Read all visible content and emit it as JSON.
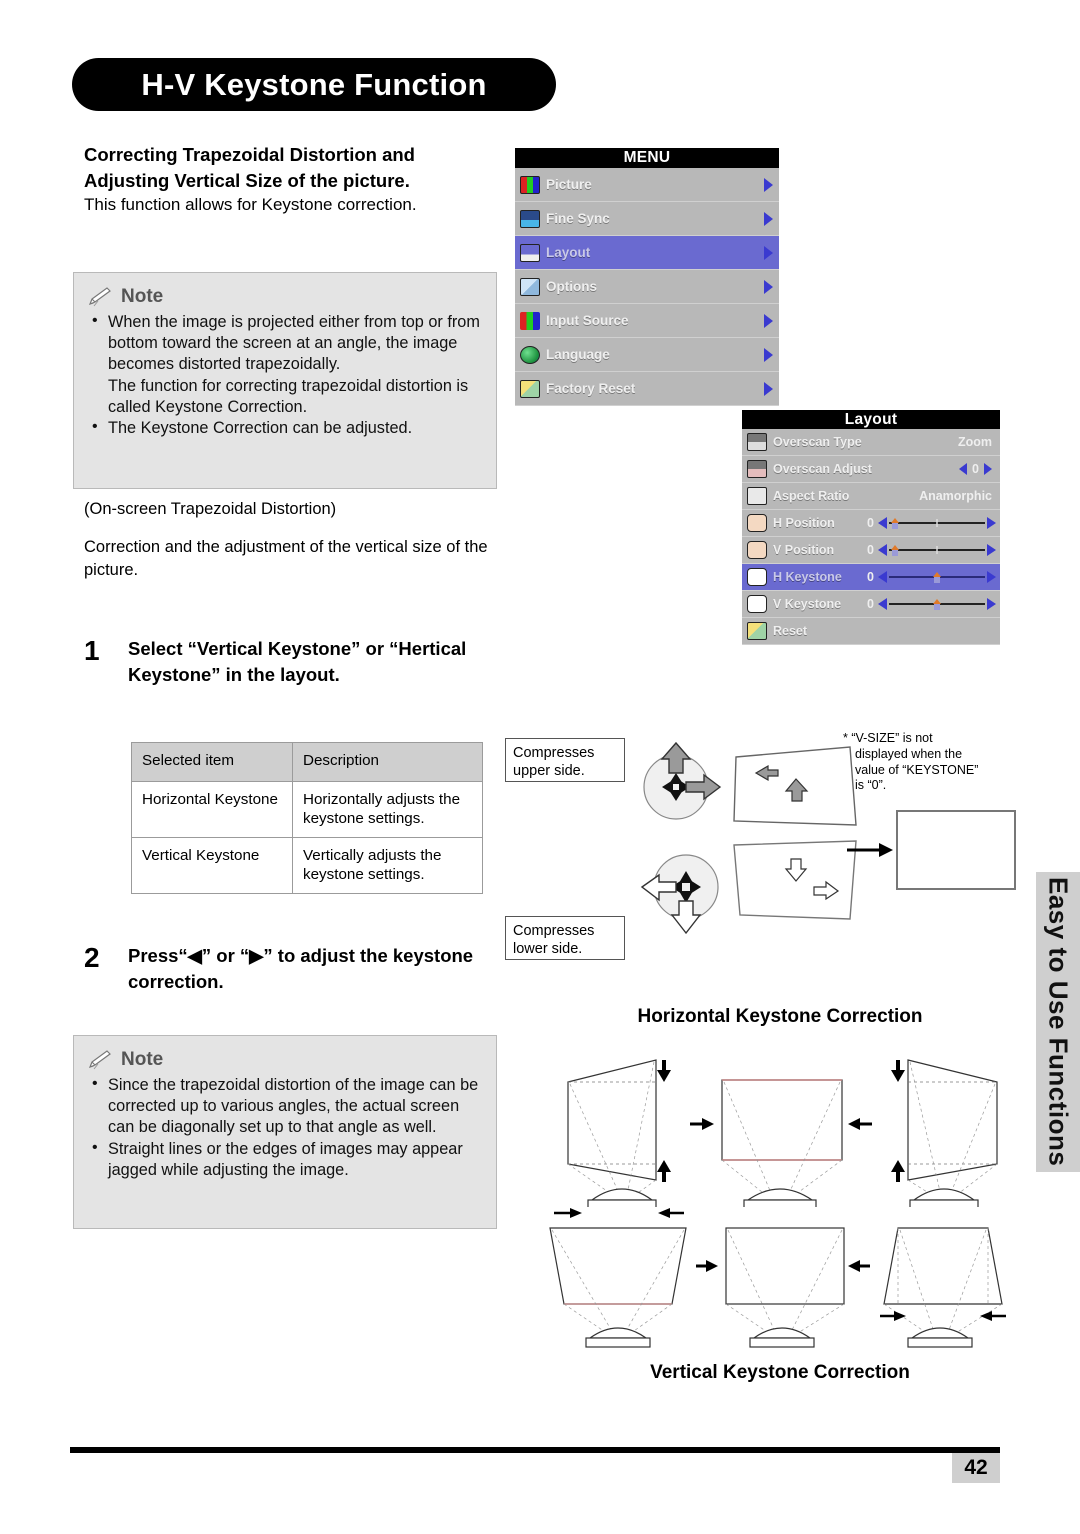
{
  "header": {
    "title": "H-V Keystone Function"
  },
  "intro": {
    "heading": "Correcting Trapezoidal Distortion and Adjusting Vertical Size of the picture.",
    "subtext": "This function allows for Keystone correction."
  },
  "note1": {
    "label": "Note",
    "items": [
      "When the image is projected either from top or from bottom toward the screen at an angle, the image becomes distorted trapezoidally.",
      "The function for correcting trapezoidal distortion is called Keystone Correction.",
      "The Keystone Correction can be adjusted."
    ]
  },
  "body": {
    "line1": "(On-screen Trapezoidal Distortion)",
    "line2": "Correction and the adjustment of the vertical size of the picture."
  },
  "steps": [
    {
      "number": "1",
      "text": "Select “Vertical Keystone” or “Hertical Keystone” in the layout."
    },
    {
      "number": "2",
      "text": "Press“◀” or “▶” to adjust the keystone correction."
    }
  ],
  "table": {
    "headers": [
      "Selected item",
      "Description"
    ],
    "rows": [
      {
        "item": "Horizontal Keystone",
        "description": "Horizontally adjusts the keystone settings."
      },
      {
        "item": "Vertical Keystone",
        "description": "Vertically adjusts the keystone settings."
      }
    ]
  },
  "note2": {
    "label": "Note",
    "items": [
      "Since the trapezoidal distortion of the image can be corrected up to various angles, the actual screen can be diagonally set up to that angle as well.",
      "Straight lines or the edges of images may appear jagged while adjusting the image."
    ]
  },
  "osd_main": {
    "title": "MENU",
    "items": [
      {
        "label": "Picture",
        "icon": "picture-icon",
        "selected": false
      },
      {
        "label": "Fine Sync",
        "icon": "fine-sync-icon",
        "selected": false
      },
      {
        "label": "Layout",
        "icon": "layout-icon",
        "selected": true
      },
      {
        "label": "Options",
        "icon": "options-icon",
        "selected": false
      },
      {
        "label": "Input Source",
        "icon": "input-source-icon",
        "selected": false
      },
      {
        "label": "Language",
        "icon": "language-icon",
        "selected": false
      },
      {
        "label": "Factory Reset",
        "icon": "factory-reset-icon",
        "selected": false
      }
    ]
  },
  "osd_layout": {
    "title": "Layout",
    "items": [
      {
        "label": "Overscan Type",
        "icon": "overscan-type-icon",
        "value": "Zoom",
        "control": "text",
        "selected": false
      },
      {
        "label": "Overscan Adjust",
        "icon": "overscan-adjust-icon",
        "value": "0",
        "control": "spin",
        "selected": false
      },
      {
        "label": "Aspect Ratio",
        "icon": "aspect-ratio-icon",
        "value": "Anamorphic",
        "control": "text",
        "selected": false
      },
      {
        "label": "H Position",
        "icon": "h-position-icon",
        "value": "0",
        "control": "slider",
        "knob": 12,
        "selected": false
      },
      {
        "label": "V Position",
        "icon": "v-position-icon",
        "value": "0",
        "control": "slider",
        "knob": 12,
        "selected": false
      },
      {
        "label": "H Keystone",
        "icon": "h-keystone-icon",
        "value": "0",
        "control": "slider",
        "knob": 50,
        "selected": true
      },
      {
        "label": "V Keystone",
        "icon": "v-keystone-icon",
        "value": "0",
        "control": "slider",
        "knob": 50,
        "selected": false
      },
      {
        "label": "Reset",
        "icon": "reset-icon",
        "value": "",
        "control": "none",
        "selected": false
      }
    ]
  },
  "diagram": {
    "caption_upper": "Compresses upper side.",
    "caption_lower": "Compresses lower side.",
    "vsize_note_line1": "* “V-SIZE” is not",
    "vsize_note_line2": "displayed when the",
    "vsize_note_line3": "value of “KEYSTONE”",
    "vsize_note_line4": "is “0”.",
    "horizontal_title": "Horizontal Keystone Correction",
    "vertical_title": "Vertical Keystone Correction"
  },
  "side_tab": {
    "label": "Easy to Use Functions"
  },
  "footer": {
    "page_number": "42"
  },
  "colors": {
    "osd_selected": "#6a6ad0",
    "osd_row": "#b8b8b8",
    "osd_bar": "#000000",
    "note_bg": "#e4e4e4",
    "table_header": "#cfcfcf",
    "side_tab_bg": "#cfcfcf"
  }
}
